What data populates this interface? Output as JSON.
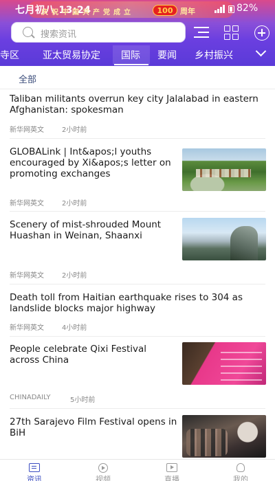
{
  "status_bar": {
    "time": "七月初八 13:24",
    "banner": "庆祝中国共产党成立",
    "logo_text": "100",
    "banner_suffix": "周年",
    "network": "4G 5G",
    "battery": "82%"
  },
  "header": {
    "search_placeholder": "搜索资讯",
    "icons": [
      "menu-icon",
      "grid-icon",
      "add-icon"
    ],
    "tabs": [
      {
        "label": "寺区",
        "active": false
      },
      {
        "label": "亚太贸易协定",
        "active": false
      },
      {
        "label": "国际",
        "active": true
      },
      {
        "label": "要闻",
        "active": false
      },
      {
        "label": "乡村振兴",
        "active": false
      }
    ],
    "more_icon": "chevron-down-icon"
  },
  "filter": {
    "label": "全部"
  },
  "news": [
    {
      "title": "Taliban militants overrun key city Jalalabad in eastern Afghanistan: spokesman",
      "source": "新华网英文",
      "time": "2小时前",
      "thumbnail": null
    },
    {
      "title": "GLOBALink | Int&apos;l youths encouraged by Xi&apos;s letter on promoting exchanges",
      "source": "新华网英文",
      "time": "2小时前",
      "thumbnail": "village-landscape"
    },
    {
      "title": "Scenery of mist-shrouded Mount Huashan in Weinan, Shaanxi",
      "source": "新华网英文",
      "time": "2小时前",
      "thumbnail": "misty-mountain"
    },
    {
      "title": "Death toll from Haitian earthquake rises to 304 as landslide blocks major highway",
      "source": "新华网英文",
      "time": "4小时前",
      "thumbnail": null
    },
    {
      "title": "People celebrate Qixi Festival across China",
      "source": "CHINADAILY",
      "time": "5小时前",
      "thumbnail": "festival-wall"
    },
    {
      "title": "27th Sarajevo Film Festival opens in BiH",
      "source": "",
      "time": "",
      "thumbnail": "film-festival-crowd"
    }
  ],
  "bottom_nav": [
    {
      "label": "资讯",
      "icon": "news-icon",
      "active": true
    },
    {
      "label": "视频",
      "icon": "video-icon",
      "active": false
    },
    {
      "label": "直播",
      "icon": "live-icon",
      "active": false
    },
    {
      "label": "我的",
      "icon": "profile-icon",
      "active": false
    }
  ],
  "colors": {
    "header_top": "#d94a8c",
    "header_bottom": "#5a3ad8",
    "active_nav": "#3a4cc0",
    "meta_text": "#888888",
    "filter_text": "#3a4c7a"
  }
}
